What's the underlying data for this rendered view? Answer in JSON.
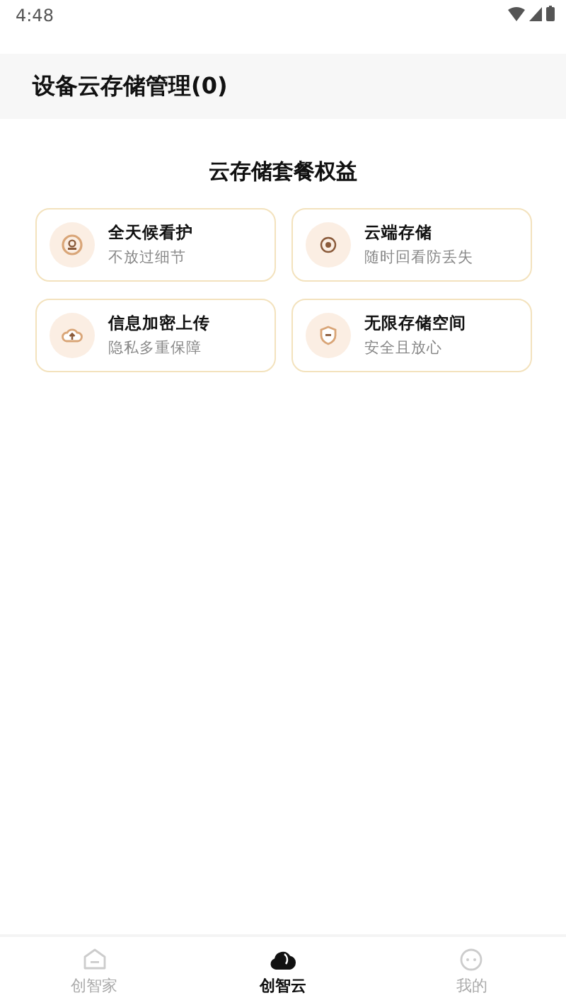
{
  "status_bar": {
    "time": "4:48"
  },
  "header": {
    "title": "设备云存储管理(0)"
  },
  "section": {
    "title": "云存储套餐权益"
  },
  "benefits": [
    {
      "kind": "camera",
      "title": "全天候看护",
      "subtitle": "不放过细节"
    },
    {
      "kind": "record",
      "title": "云端存储",
      "subtitle": "随时回看防丢失"
    },
    {
      "kind": "upload",
      "title": "信息加密上传",
      "subtitle": "隐私多重保障"
    },
    {
      "kind": "shield",
      "title": "无限存储空间",
      "subtitle": "安全且放心"
    }
  ],
  "tab_bar": [
    {
      "kind": "home",
      "label": "创智家",
      "selected": false
    },
    {
      "kind": "cloud",
      "label": "创智云",
      "selected": true
    },
    {
      "kind": "face",
      "label": "我的",
      "selected": false
    }
  ]
}
